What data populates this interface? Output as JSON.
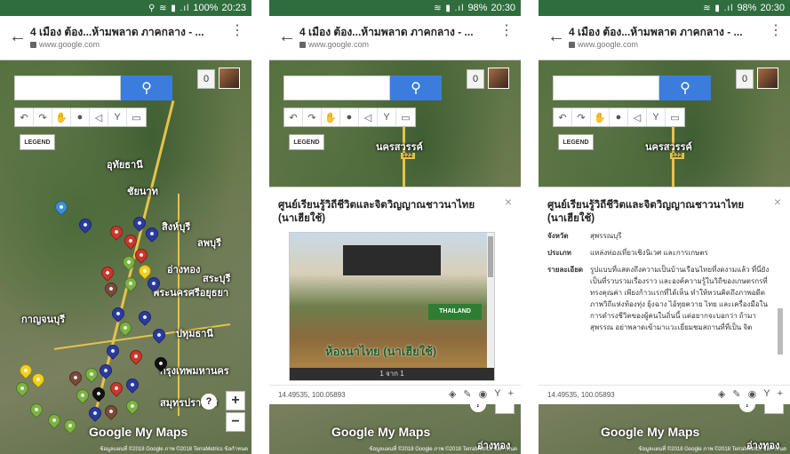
{
  "phones": [
    {
      "status": {
        "icons": "⚲ ≋ ▮ .ıl",
        "battery": "100%",
        "time": "20:23"
      },
      "map_labels": [
        "อุทัยธานี",
        "ชัยนาท",
        "สิงห์บุรี",
        "ลพบุรี",
        "อ่างทอง",
        "สระบุรี",
        "พระนครศรีอยุธยา",
        "กาญจนบุรี",
        "ปทุมธานี",
        "กรุงเทพมหานคร",
        "สมุทรปราการ"
      ]
    },
    {
      "status": {
        "icons": "≋ ▮ .ıl",
        "battery": "98%",
        "time": "20:30"
      },
      "map_labels": [
        "นครสวรรค์",
        "อ่างทอง"
      ]
    },
    {
      "status": {
        "icons": "≋ ▮ .ıl",
        "battery": "98%",
        "time": "20:30"
      },
      "map_labels": [
        "นครสวรรค์",
        "อ่างทอง"
      ]
    }
  ],
  "browser": {
    "title": "4 เมือง ต้อง...ห้ามพลาด ภาคกลาง - ...",
    "url": "www.google.com"
  },
  "map": {
    "count_badge": "0",
    "legend_label": "LEGEND",
    "zoom_in": "+",
    "zoom_out": "−",
    "help": "?",
    "brand": "Google My Maps",
    "copyright": "ข้อมูลแผนที่ ©2018 Google ภาพ ©2018 TerraMetrics ข้อกำหนด",
    "road_number": "122"
  },
  "place": {
    "title": "ศูนย์เรียนรู้วิถีชีวิตและจิตวิญญาณชาวนาไทย (นาเฮียใช้)",
    "photo_caption": "ห้องนาไทย (นาเฮียใช้)",
    "photo_badge": "THAILAND",
    "photo_counter": "1 จาก 1",
    "coords": "14.49535, 100.05893",
    "fields": [
      {
        "key": "จังหวัด",
        "value": "สุพรรณบุรี"
      },
      {
        "key": "ประเภท",
        "value": "แหล่งท่องเที่ยวเชิงนิเวศ และการเกษตร"
      },
      {
        "key": "รายละเอียด",
        "value": "รูปแบบที่แสดงถึงความเป็นบ้านเรือนไทยที่งดงามแล้ว ที่นี่ยังเป็นที่รวบรวมเรื่องราว และองค์ความรู้ในวิถีของเกษตรกรที่ทรงคุณค่า เพียงก้าวแรกที่ได้เห็น ทำให้หวนคิดถึงภาพอดีต ภาพวิถีแห่งท้องทุ่ง ยุ้งฉาง ไอ้ทุยควาย ไทย และเครื่องมือในการดำรงชีวิตของผู้คนในถิ่นนี้ แต่อยากจะบอกว่า ถ้ามาสุพรรณ อย่าพลาดเข้ามาแวะเยี่ยมชมสถานที่ที่เป็น จิต"
      }
    ]
  },
  "colors": {
    "pin_blue": "#2a3ba0",
    "pin_red": "#c9372c",
    "pin_green": "#7cb342",
    "pin_yellow": "#f2d21a",
    "pin_brown": "#7b4b3a",
    "pin_black": "#111111",
    "pin_lightblue": "#3f8fd6",
    "search_blue": "#3b7ddd"
  }
}
